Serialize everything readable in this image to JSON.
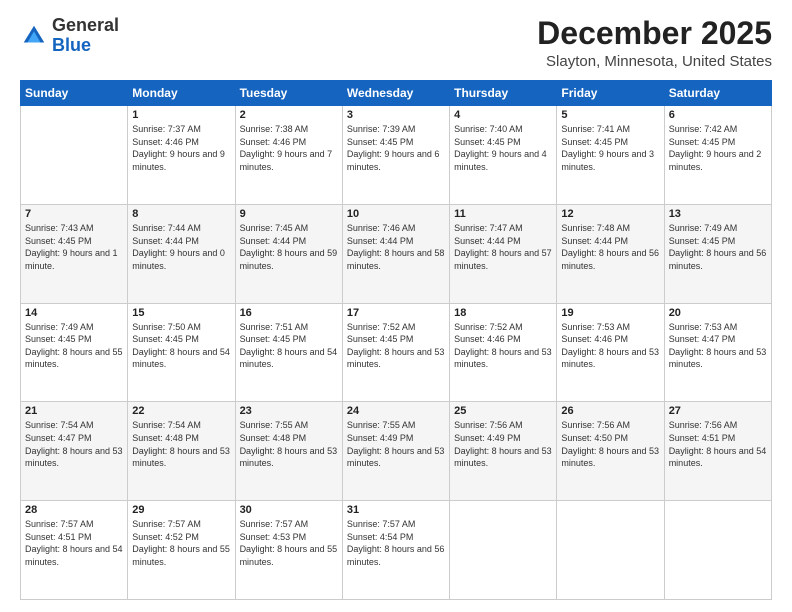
{
  "logo": {
    "general": "General",
    "blue": "Blue"
  },
  "header": {
    "month": "December 2025",
    "location": "Slayton, Minnesota, United States"
  },
  "weekdays": [
    "Sunday",
    "Monday",
    "Tuesday",
    "Wednesday",
    "Thursday",
    "Friday",
    "Saturday"
  ],
  "weeks": [
    [
      {
        "day": "",
        "sunrise": "",
        "sunset": "",
        "daylight": ""
      },
      {
        "day": "1",
        "sunrise": "Sunrise: 7:37 AM",
        "sunset": "Sunset: 4:46 PM",
        "daylight": "Daylight: 9 hours and 9 minutes."
      },
      {
        "day": "2",
        "sunrise": "Sunrise: 7:38 AM",
        "sunset": "Sunset: 4:46 PM",
        "daylight": "Daylight: 9 hours and 7 minutes."
      },
      {
        "day": "3",
        "sunrise": "Sunrise: 7:39 AM",
        "sunset": "Sunset: 4:45 PM",
        "daylight": "Daylight: 9 hours and 6 minutes."
      },
      {
        "day": "4",
        "sunrise": "Sunrise: 7:40 AM",
        "sunset": "Sunset: 4:45 PM",
        "daylight": "Daylight: 9 hours and 4 minutes."
      },
      {
        "day": "5",
        "sunrise": "Sunrise: 7:41 AM",
        "sunset": "Sunset: 4:45 PM",
        "daylight": "Daylight: 9 hours and 3 minutes."
      },
      {
        "day": "6",
        "sunrise": "Sunrise: 7:42 AM",
        "sunset": "Sunset: 4:45 PM",
        "daylight": "Daylight: 9 hours and 2 minutes."
      }
    ],
    [
      {
        "day": "7",
        "sunrise": "Sunrise: 7:43 AM",
        "sunset": "Sunset: 4:45 PM",
        "daylight": "Daylight: 9 hours and 1 minute."
      },
      {
        "day": "8",
        "sunrise": "Sunrise: 7:44 AM",
        "sunset": "Sunset: 4:44 PM",
        "daylight": "Daylight: 9 hours and 0 minutes."
      },
      {
        "day": "9",
        "sunrise": "Sunrise: 7:45 AM",
        "sunset": "Sunset: 4:44 PM",
        "daylight": "Daylight: 8 hours and 59 minutes."
      },
      {
        "day": "10",
        "sunrise": "Sunrise: 7:46 AM",
        "sunset": "Sunset: 4:44 PM",
        "daylight": "Daylight: 8 hours and 58 minutes."
      },
      {
        "day": "11",
        "sunrise": "Sunrise: 7:47 AM",
        "sunset": "Sunset: 4:44 PM",
        "daylight": "Daylight: 8 hours and 57 minutes."
      },
      {
        "day": "12",
        "sunrise": "Sunrise: 7:48 AM",
        "sunset": "Sunset: 4:44 PM",
        "daylight": "Daylight: 8 hours and 56 minutes."
      },
      {
        "day": "13",
        "sunrise": "Sunrise: 7:49 AM",
        "sunset": "Sunset: 4:45 PM",
        "daylight": "Daylight: 8 hours and 56 minutes."
      }
    ],
    [
      {
        "day": "14",
        "sunrise": "Sunrise: 7:49 AM",
        "sunset": "Sunset: 4:45 PM",
        "daylight": "Daylight: 8 hours and 55 minutes."
      },
      {
        "day": "15",
        "sunrise": "Sunrise: 7:50 AM",
        "sunset": "Sunset: 4:45 PM",
        "daylight": "Daylight: 8 hours and 54 minutes."
      },
      {
        "day": "16",
        "sunrise": "Sunrise: 7:51 AM",
        "sunset": "Sunset: 4:45 PM",
        "daylight": "Daylight: 8 hours and 54 minutes."
      },
      {
        "day": "17",
        "sunrise": "Sunrise: 7:52 AM",
        "sunset": "Sunset: 4:45 PM",
        "daylight": "Daylight: 8 hours and 53 minutes."
      },
      {
        "day": "18",
        "sunrise": "Sunrise: 7:52 AM",
        "sunset": "Sunset: 4:46 PM",
        "daylight": "Daylight: 8 hours and 53 minutes."
      },
      {
        "day": "19",
        "sunrise": "Sunrise: 7:53 AM",
        "sunset": "Sunset: 4:46 PM",
        "daylight": "Daylight: 8 hours and 53 minutes."
      },
      {
        "day": "20",
        "sunrise": "Sunrise: 7:53 AM",
        "sunset": "Sunset: 4:47 PM",
        "daylight": "Daylight: 8 hours and 53 minutes."
      }
    ],
    [
      {
        "day": "21",
        "sunrise": "Sunrise: 7:54 AM",
        "sunset": "Sunset: 4:47 PM",
        "daylight": "Daylight: 8 hours and 53 minutes."
      },
      {
        "day": "22",
        "sunrise": "Sunrise: 7:54 AM",
        "sunset": "Sunset: 4:48 PM",
        "daylight": "Daylight: 8 hours and 53 minutes."
      },
      {
        "day": "23",
        "sunrise": "Sunrise: 7:55 AM",
        "sunset": "Sunset: 4:48 PM",
        "daylight": "Daylight: 8 hours and 53 minutes."
      },
      {
        "day": "24",
        "sunrise": "Sunrise: 7:55 AM",
        "sunset": "Sunset: 4:49 PM",
        "daylight": "Daylight: 8 hours and 53 minutes."
      },
      {
        "day": "25",
        "sunrise": "Sunrise: 7:56 AM",
        "sunset": "Sunset: 4:49 PM",
        "daylight": "Daylight: 8 hours and 53 minutes."
      },
      {
        "day": "26",
        "sunrise": "Sunrise: 7:56 AM",
        "sunset": "Sunset: 4:50 PM",
        "daylight": "Daylight: 8 hours and 53 minutes."
      },
      {
        "day": "27",
        "sunrise": "Sunrise: 7:56 AM",
        "sunset": "Sunset: 4:51 PM",
        "daylight": "Daylight: 8 hours and 54 minutes."
      }
    ],
    [
      {
        "day": "28",
        "sunrise": "Sunrise: 7:57 AM",
        "sunset": "Sunset: 4:51 PM",
        "daylight": "Daylight: 8 hours and 54 minutes."
      },
      {
        "day": "29",
        "sunrise": "Sunrise: 7:57 AM",
        "sunset": "Sunset: 4:52 PM",
        "daylight": "Daylight: 8 hours and 55 minutes."
      },
      {
        "day": "30",
        "sunrise": "Sunrise: 7:57 AM",
        "sunset": "Sunset: 4:53 PM",
        "daylight": "Daylight: 8 hours and 55 minutes."
      },
      {
        "day": "31",
        "sunrise": "Sunrise: 7:57 AM",
        "sunset": "Sunset: 4:54 PM",
        "daylight": "Daylight: 8 hours and 56 minutes."
      },
      {
        "day": "",
        "sunrise": "",
        "sunset": "",
        "daylight": ""
      },
      {
        "day": "",
        "sunrise": "",
        "sunset": "",
        "daylight": ""
      },
      {
        "day": "",
        "sunrise": "",
        "sunset": "",
        "daylight": ""
      }
    ]
  ]
}
